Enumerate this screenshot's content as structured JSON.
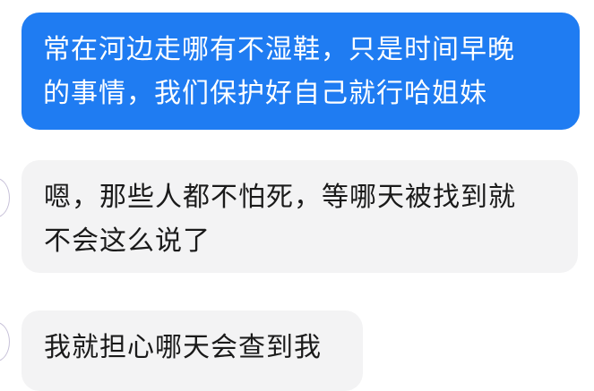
{
  "messages": [
    {
      "direction": "outgoing",
      "lines": [
        "常在河边走哪有不湿鞋，只是时间早晚",
        "的事情，我们保护好自己就行哈姐妹"
      ]
    },
    {
      "direction": "incoming",
      "lines": [
        "嗯，那些人都不怕死，等哪天被找到就",
        "不会这么说了"
      ]
    },
    {
      "direction": "incoming",
      "lines": [
        "我就担心哪天会查到我"
      ]
    }
  ],
  "colors": {
    "outgoing_bubble": "#1f7cf2",
    "incoming_bubble": "#f3f3f4",
    "outgoing_text": "#ffffff",
    "incoming_text": "#1a1a1a"
  }
}
